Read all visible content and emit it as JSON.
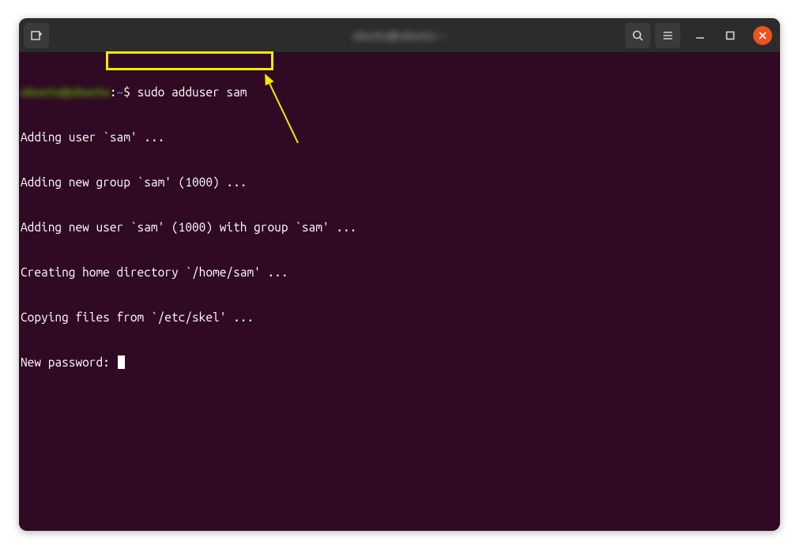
{
  "window": {
    "title": "ubuntu@ubuntu: ~"
  },
  "terminal": {
    "prompt_user": "ubuntu@ubuntu",
    "prompt_sep": ":",
    "prompt_path": "~",
    "prompt_dollar": "$ ",
    "command": "sudo adduser sam",
    "output": [
      "Adding user `sam' ...",
      "Adding new group `sam' (1000) ...",
      "Adding new user `sam' (1000) with group `sam' ...",
      "Creating home directory `/home/sam' ...",
      "Copying files from `/etc/skel' ...",
      "New password: "
    ]
  }
}
